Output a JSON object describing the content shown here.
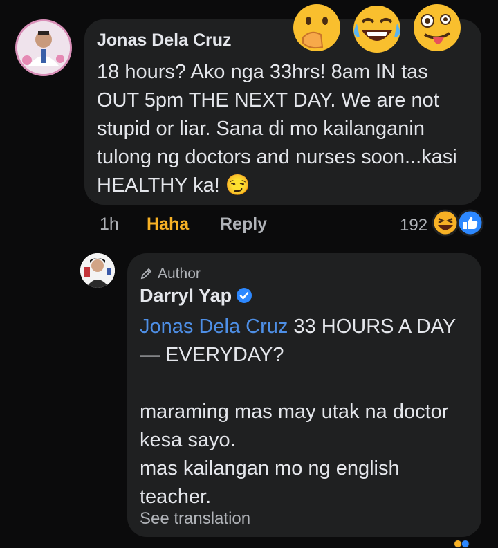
{
  "comment": {
    "author": "Jonas Dela Cruz",
    "text": "18 hours? Ako nga 33hrs! 8am IN tas OUT 5pm THE NEXT DAY. We are not stupid or liar. Sana di mo kailanganin tulong ng doctors and nurses soon...kasi HEALTHY ka! 😏",
    "time": "1h",
    "reaction_label": "Haha",
    "reply_label": "Reply",
    "reaction_count": "192",
    "overlay_emojis": [
      "hand-over-mouth-emoji-icon",
      "tears-of-joy-emoji-icon",
      "zany-face-emoji-icon"
    ],
    "reaction_icons": [
      "haha-reaction-icon",
      "like-reaction-icon"
    ]
  },
  "reply": {
    "badge": "Author",
    "author": "Darryl Yap",
    "mention": "Jonas Dela Cruz",
    "line1_rest": " 33 HOURS A DAY— EVERYDAY?",
    "line2": "maraming mas may utak na doctor kesa sayo.",
    "line3": "mas kailangan mo ng english teacher.",
    "see_translation": "See translation"
  },
  "colors": {
    "background": "#0b0b0c",
    "bubble": "#1f2021",
    "text_primary": "#e4e6eb",
    "text_secondary": "#b0b3b8",
    "haha_accent": "#f7b125",
    "mention": "#4e8fe6",
    "verified": "#2d88ff"
  }
}
